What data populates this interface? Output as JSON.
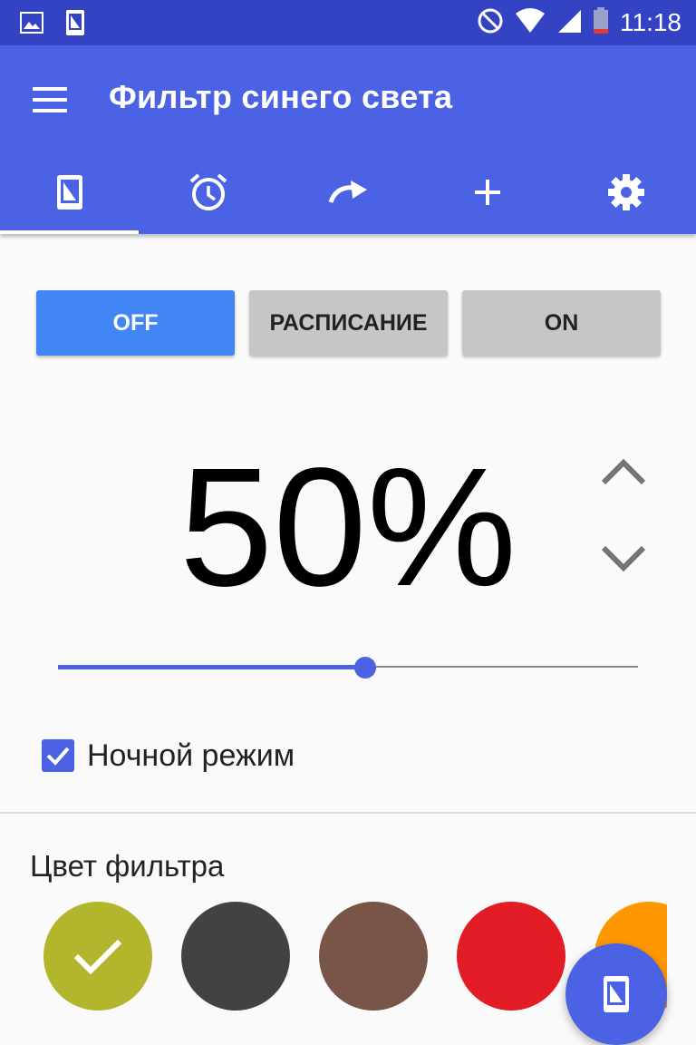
{
  "status_bar": {
    "time": "11:18",
    "left_icons": [
      "image-icon",
      "filter-phone-icon"
    ],
    "right_icons": [
      "do-not-disturb-icon",
      "wifi-icon",
      "signal-icon",
      "battery-icon"
    ]
  },
  "app_bar": {
    "title": "Фильтр синего света",
    "menu_icon": "menu-icon",
    "tabs": [
      {
        "icon": "filter-phone-icon",
        "active": true
      },
      {
        "icon": "alarm-icon",
        "active": false
      },
      {
        "icon": "redo-icon",
        "active": false
      },
      {
        "icon": "plus-icon",
        "active": false
      },
      {
        "icon": "gear-icon",
        "active": false
      }
    ]
  },
  "mode_buttons": {
    "off": "OFF",
    "schedule": "РАСПИСАНИЕ",
    "on": "ON",
    "selected": "off"
  },
  "intensity": {
    "value_text": "50%",
    "value": 50,
    "slider_fraction": 0.53
  },
  "night_mode": {
    "label": "Ночной режим",
    "checked": true
  },
  "filter_color": {
    "title": "Цвет фильтра",
    "colors": [
      "#b2b62d",
      "#424242",
      "#795548",
      "#e21c24",
      "#ff9800"
    ],
    "selected_index": 0
  },
  "colors": {
    "primary": "#4a62e3",
    "status_bar": "#3343c4",
    "active_button": "#4285f4",
    "inactive_button": "#c6c6c6"
  }
}
